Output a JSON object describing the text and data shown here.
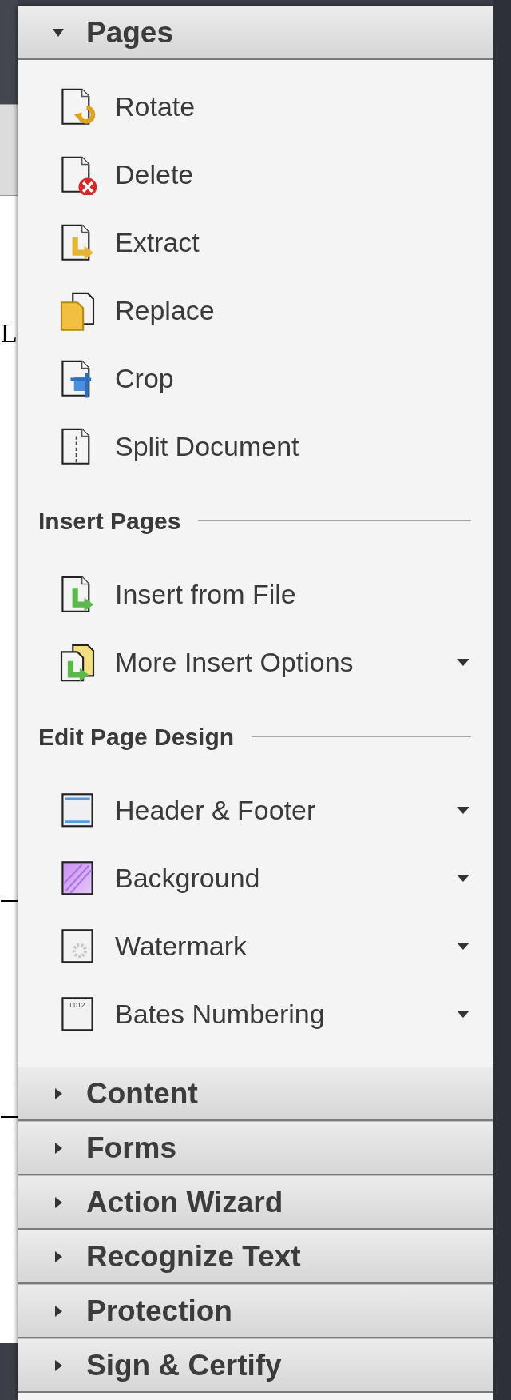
{
  "background_document": {
    "fragments": [
      "L"
    ]
  },
  "panel": {
    "sections": [
      {
        "title": "Pages",
        "expanded": true,
        "items": [
          {
            "label": "Rotate",
            "kind": "rotate",
            "has_menu": false
          },
          {
            "label": "Delete",
            "kind": "delete",
            "has_menu": false
          },
          {
            "label": "Extract",
            "kind": "extract",
            "has_menu": false
          },
          {
            "label": "Replace",
            "kind": "replace",
            "has_menu": false
          },
          {
            "label": "Crop",
            "kind": "crop",
            "has_menu": false
          },
          {
            "label": "Split Document",
            "kind": "split",
            "has_menu": false
          }
        ],
        "groups": [
          {
            "title": "Insert Pages",
            "items": [
              {
                "label": "Insert from File",
                "kind": "insert",
                "has_menu": false
              },
              {
                "label": "More Insert Options",
                "kind": "more_insert",
                "has_menu": true
              }
            ]
          },
          {
            "title": "Edit Page Design",
            "items": [
              {
                "label": "Header & Footer",
                "kind": "header_footer",
                "has_menu": true
              },
              {
                "label": "Background",
                "kind": "background",
                "has_menu": true
              },
              {
                "label": "Watermark",
                "kind": "watermark",
                "has_menu": true
              },
              {
                "label": "Bates Numbering",
                "kind": "bates",
                "has_menu": true,
                "icon_text": "0012"
              }
            ]
          }
        ]
      },
      {
        "title": "Content",
        "expanded": false
      },
      {
        "title": "Forms",
        "expanded": false
      },
      {
        "title": "Action Wizard",
        "expanded": false
      },
      {
        "title": "Recognize Text",
        "expanded": false
      },
      {
        "title": "Protection",
        "expanded": false
      },
      {
        "title": "Sign & Certify",
        "expanded": false
      }
    ]
  }
}
